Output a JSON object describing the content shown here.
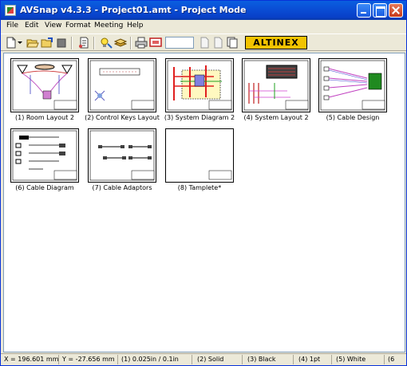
{
  "window": {
    "title": "AVSnap v4.3.3 - Project01.amt  - Project Mode"
  },
  "menu": [
    "File",
    "Edit",
    "View",
    "Format",
    "Meeting",
    "Help"
  ],
  "toolbar": {
    "logo_text": "ALTINEX",
    "zoom_value": "",
    "tools": [
      "new-page-icon",
      "dropdown-arrow-icon",
      "open-folder-icon",
      "save-folder-icon",
      "stop-icon",
      "page-view-icon",
      "light-bulb-icon",
      "layers-icon",
      "print-icon",
      "presentation-icon",
      "document-icon",
      "document-icon",
      "copy-pages-icon"
    ]
  },
  "pages": [
    {
      "label": "(1) Room Layout 2",
      "icon": "room-layout-thumbnail"
    },
    {
      "label": "(2) Control Keys Layout",
      "icon": "control-keys-thumbnail"
    },
    {
      "label": "(3) System Diagram 2",
      "icon": "system-diagram-thumbnail"
    },
    {
      "label": "(4) System Layout 2",
      "icon": "system-layout-thumbnail"
    },
    {
      "label": "(5) Cable Design",
      "icon": "cable-design-thumbnail"
    },
    {
      "label": "(6) Cable Diagram",
      "icon": "cable-diagram-thumbnail"
    },
    {
      "label": "(7) Cable Adaptors",
      "icon": "cable-adaptors-thumbnail"
    },
    {
      "label": "(8) Tamplete*",
      "icon": "blank-template-thumbnail"
    }
  ],
  "status": {
    "x": "X = 196.601 mm",
    "y": "Y = -27.656 mm",
    "grid": "(1) 0.025in / 0.1in",
    "line_style": "(2) Solid",
    "color": "(3) Black",
    "width": "(4) 1pt",
    "fill": "(5) White",
    "extra": "(6"
  }
}
